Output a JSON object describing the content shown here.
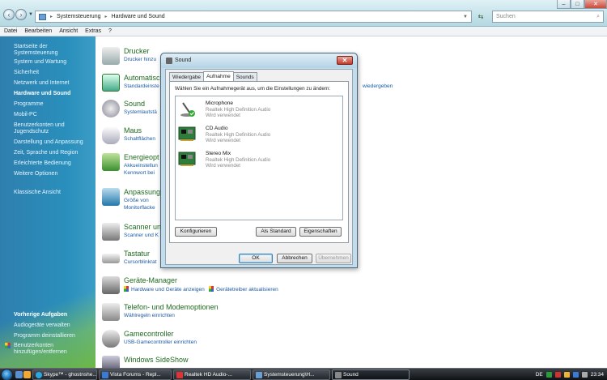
{
  "addressbar": {
    "crumbs": [
      "Systemsteuerung",
      "Hardware und Sound"
    ],
    "search_placeholder": "Suchen"
  },
  "menubar": [
    "Datei",
    "Bearbeiten",
    "Ansicht",
    "Extras",
    "?"
  ],
  "sidebar": {
    "links": [
      "Startseite der Systemsteuerung",
      "System und Wartung",
      "Sicherheit",
      "Netzwerk und Internet",
      "Hardware und Sound",
      "Programme",
      "Mobil-PC",
      "Benutzerkonten und Jugendschutz",
      "Darstellung und Anpassung",
      "Zeit, Sprache und Region",
      "Erleichterte Bedienung",
      "Weitere Optionen",
      "Klassische Ansicht"
    ],
    "recent_heading": "Vorherige Aufgaben",
    "recent": [
      "Audiogeräte verwalten",
      "Programm deinstallieren",
      "Benutzerkonten hinzufügen/entfernen"
    ]
  },
  "categories": [
    {
      "title": "Drucker",
      "sub": "Drucker hinzu"
    },
    {
      "title": "Automatisc",
      "sub": "Standardeinste",
      "extra": "wiedergeben"
    },
    {
      "title": "Sound",
      "sub": "Systemlautstä"
    },
    {
      "title": "Maus",
      "sub": "Schaltflächen"
    },
    {
      "title": "Energieopt",
      "sub": "Akkueinstellun",
      "sub2": "Kennwort bei"
    },
    {
      "title": "Anpassung",
      "sub": "Größe von",
      "sub2": "Monitorflacke"
    },
    {
      "title": "Scanner un",
      "sub": "Scanner und K"
    },
    {
      "title": "Tastatur",
      "sub": "Cursorblinkrat"
    },
    {
      "title": "Geräte-Manager",
      "sub": "Hardware und Geräte anzeigen",
      "sub_b": "Gerätetreiber aktualisieren"
    },
    {
      "title": "Telefon- und Modemoptionen",
      "sub": "Wählregeln einrichten"
    },
    {
      "title": "Gamecontroller",
      "sub": "USB-Gamecontroller einrichten"
    },
    {
      "title": "Windows SideShow",
      "sub": ""
    }
  ],
  "dialog": {
    "title": "Sound",
    "tabs": [
      "Wiedergabe",
      "Aufnahme",
      "Sounds"
    ],
    "instruction": "Wählen Sie ein Aufnahmegerät aus, um die Einstellungen zu ändern:",
    "devices": [
      {
        "name": "Microphone",
        "driver": "Realtek High Definition Audio",
        "status": "Wird verwendet"
      },
      {
        "name": "CD Audio",
        "driver": "Realtek High Definition Audio",
        "status": "Wird verwendet"
      },
      {
        "name": "Stereo Mix",
        "driver": "Realtek High Definition Audio",
        "status": "Wird verwendet"
      }
    ],
    "btn_configure": "Konfigurieren",
    "btn_default": "Als Standard",
    "btn_properties": "Eigenschaften",
    "btn_ok": "OK",
    "btn_cancel": "Abbrechen",
    "btn_apply": "Übernehmen"
  },
  "taskbar": {
    "buttons": [
      "Skype™ - ghostnshe...",
      "Vista Forums - Repl...",
      "Realtek HD Audio-...",
      "Systemsteuerung\\H...",
      "Sound"
    ],
    "lang": "DE",
    "clock": "23:34"
  }
}
